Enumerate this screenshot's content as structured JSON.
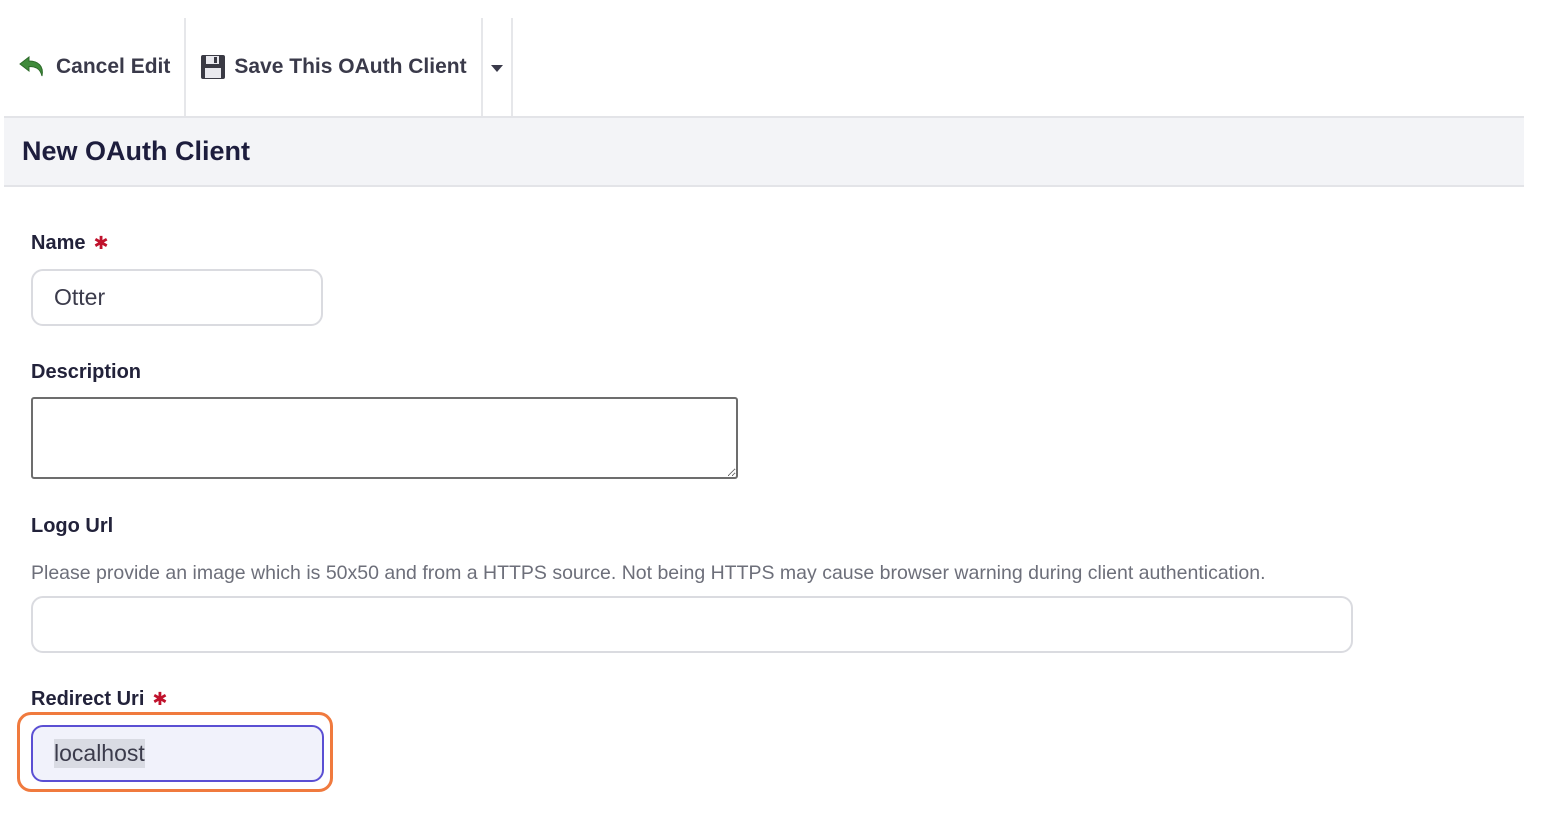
{
  "toolbar": {
    "cancel_label": "Cancel Edit",
    "save_label": "Save This OAuth Client"
  },
  "page": {
    "title": "New OAuth Client"
  },
  "form": {
    "name": {
      "label": "Name",
      "value": "Otter",
      "required": true
    },
    "description": {
      "label": "Description",
      "value": ""
    },
    "logo_url": {
      "label": "Logo Url",
      "help": "Please provide an image which is 50x50 and from a HTTPS source. Not being HTTPS may cause browser warning during client authentication.",
      "value": ""
    },
    "redirect_uri": {
      "label": "Redirect Uri",
      "value": "localhost",
      "required": true
    }
  },
  "colors": {
    "accent": "#5b4fd3",
    "highlight": "#f07a3e",
    "required": "#c0122c",
    "undo_icon": "#3f8a3a"
  },
  "icons": {
    "cancel": "undo-arrow-icon",
    "save": "floppy-disk-icon",
    "dropdown": "caret-down-icon"
  }
}
